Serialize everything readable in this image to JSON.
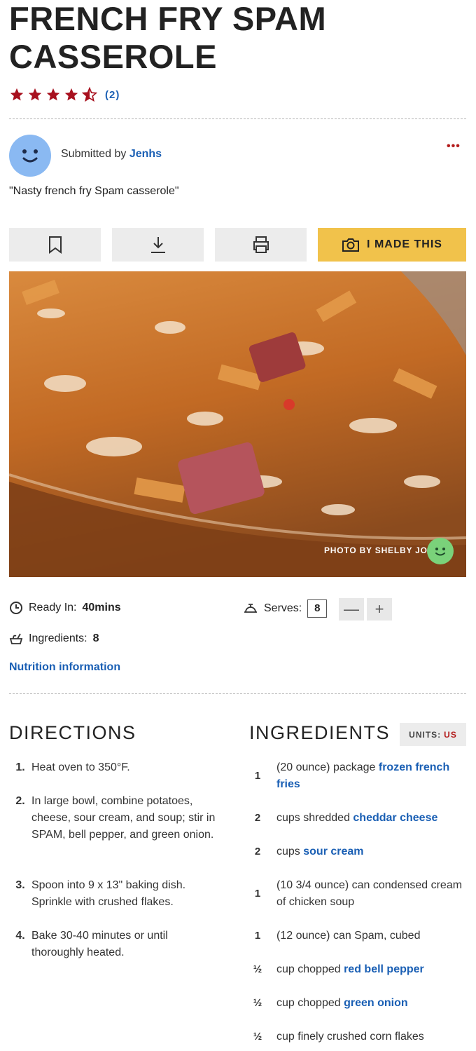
{
  "recipe": {
    "title": "FRENCH FRY SPAM CASSEROLE",
    "rating_count": "(2)",
    "rating_value": 4.5,
    "submitted_by_prefix": "Submitted by ",
    "author": "Jenhs",
    "more": "•••",
    "description": "\"Nasty french fry Spam casserole\""
  },
  "actions": {
    "made_label": "I MADE THIS"
  },
  "photo": {
    "credit": "PHOTO BY SHELBY JO"
  },
  "meta": {
    "ready_label": "Ready In:",
    "ready_value": "40mins",
    "serves_label": "Serves:",
    "serves_value": "8",
    "minus": "—",
    "plus": "+",
    "ingredients_label": "Ingredients:",
    "ingredients_value": "8",
    "nutrition": "Nutrition information"
  },
  "directions": {
    "heading": "DIRECTIONS",
    "steps": [
      {
        "num": "1.",
        "text": "Heat oven to 350°F."
      },
      {
        "num": "2.",
        "text": "In large bowl, combine potatoes, cheese, sour cream, and soup; stir in SPAM, bell pepper, and green onion."
      },
      {
        "num": "3.",
        "text": "Spoon into 9 x 13\" baking dish. Sprinkle with crushed flakes."
      },
      {
        "num": "4.",
        "text": "Bake 30-40 minutes or until thoroughly heated."
      }
    ]
  },
  "ingredients": {
    "heading": "INGREDIENTS",
    "units_label": "UNITS:",
    "units_value": "US",
    "items": [
      {
        "qty": "1",
        "pre": "(20 ounce) package ",
        "link": "frozen french fries",
        "post": ""
      },
      {
        "qty": "2",
        "pre": "cups shredded ",
        "link": "cheddar cheese",
        "post": ""
      },
      {
        "qty": "2",
        "pre": "cups ",
        "link": "sour cream",
        "post": ""
      },
      {
        "qty": "1",
        "pre": "(10 3/4 ounce) can condensed cream of chicken soup",
        "link": "",
        "post": ""
      },
      {
        "qty": "1",
        "pre": "(12 ounce) can Spam, cubed",
        "link": "",
        "post": ""
      },
      {
        "qty": "½",
        "pre": "cup chopped ",
        "link": "red bell pepper",
        "post": ""
      },
      {
        "qty": "½",
        "pre": "cup chopped ",
        "link": "green onion",
        "post": ""
      },
      {
        "qty": "½",
        "pre": "cup finely crushed corn flakes",
        "link": "",
        "post": ""
      }
    ]
  },
  "colors": {
    "star": "#a8101e",
    "link": "#1a5fb4",
    "made_button": "#f1c24b",
    "avatar": "#8ab9f2"
  }
}
